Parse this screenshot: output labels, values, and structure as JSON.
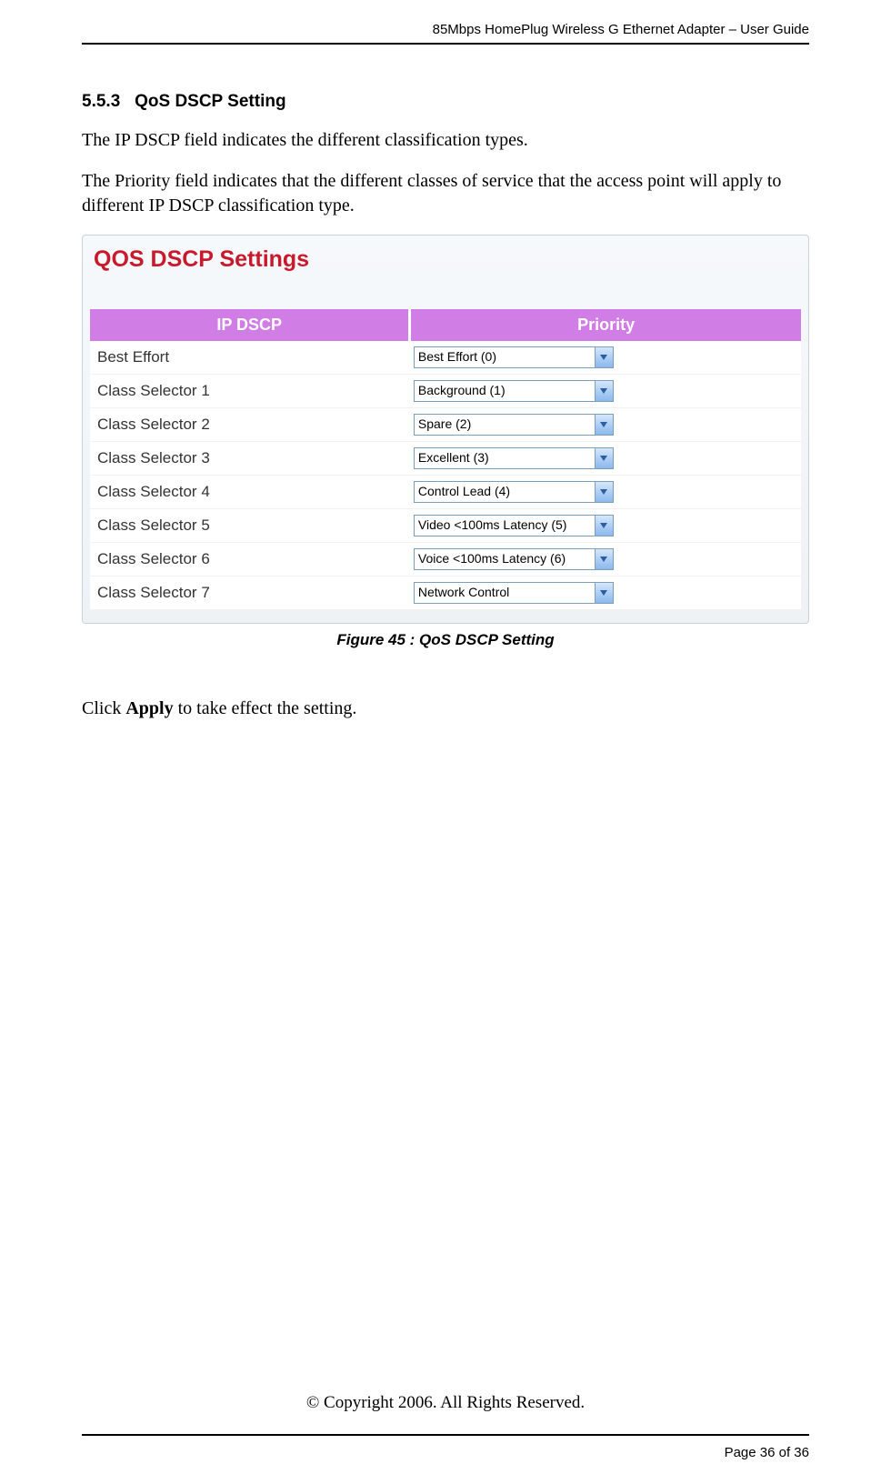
{
  "header": {
    "doc_title": "85Mbps HomePlug Wireless G Ethernet Adapter – User Guide"
  },
  "section": {
    "number": "5.5.3",
    "title": "QoS DSCP Setting"
  },
  "paragraphs": {
    "p1": "The IP DSCP field indicates the different classification types.",
    "p2": "The Priority field indicates that the different classes of service that the access point will apply to different IP DSCP classification type."
  },
  "panel": {
    "title": "QOS DSCP Settings",
    "columns": {
      "col1": "IP DSCP",
      "col2": "Priority"
    },
    "rows": [
      {
        "label": "Best Effort",
        "value": "Best Effort (0)"
      },
      {
        "label": "Class Selector 1",
        "value": "Background (1)"
      },
      {
        "label": "Class Selector 2",
        "value": "Spare (2)"
      },
      {
        "label": "Class Selector 3",
        "value": "Excellent (3)"
      },
      {
        "label": "Class Selector 4",
        "value": "Control Lead (4)"
      },
      {
        "label": "Class Selector 5",
        "value": "Video <100ms Latency (5)"
      },
      {
        "label": "Class Selector 6",
        "value": "Voice <100ms Latency (6)"
      },
      {
        "label": "Class Selector 7",
        "value": "Network Control"
      }
    ]
  },
  "figure_caption": "Figure 45 : QoS DSCP Setting",
  "apply_text": {
    "prefix": "Click ",
    "bold": "Apply",
    "suffix": " to take effect the setting."
  },
  "footer": {
    "copyright": "© Copyright 2006.  All Rights Reserved.",
    "page": "Page 36 of 36"
  }
}
